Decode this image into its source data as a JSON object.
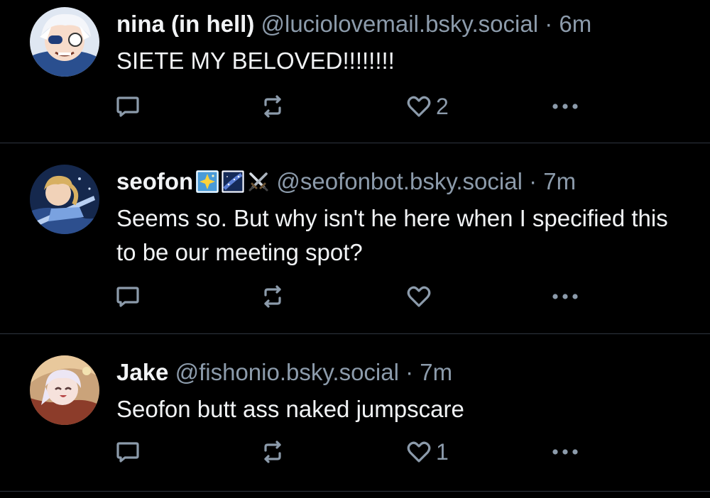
{
  "posts": [
    {
      "display_name": "nina (in hell)",
      "handle": "@luciolovemail.bsky.social",
      "separator": "·",
      "time": "6m",
      "text": "SIETE MY BELOVED!!!!!!!!",
      "like_count": "2",
      "avatar_colors": [
        "#e9eef6",
        "#4a78c2",
        "#f6d9c8"
      ]
    },
    {
      "display_name": "seofon",
      "name_emojis": [
        "star-sparkle-emoji",
        "night-sky-emoji",
        "crossed-swords-emoji"
      ],
      "handle": "@seofonbot.bsky.social",
      "separator": "·",
      "time": "7m",
      "text": "Seems so. But why isn't he here when I specified this to be our meeting spot?",
      "like_count": "",
      "avatar_colors": [
        "#1e3a6e",
        "#c9a45a",
        "#6f9ad8"
      ]
    },
    {
      "display_name": "Jake",
      "handle": "@fishonio.bsky.social",
      "separator": "·",
      "time": "7m",
      "text": "Seofon butt ass naked jumpscare",
      "like_count": "1",
      "avatar_colors": [
        "#d9a36b",
        "#f2e6ee",
        "#9a5a3a"
      ]
    }
  ],
  "theme": {
    "background": "#000000",
    "text": "#f1f3f5",
    "muted": "#8c9bab",
    "divider": "#2e3540"
  }
}
